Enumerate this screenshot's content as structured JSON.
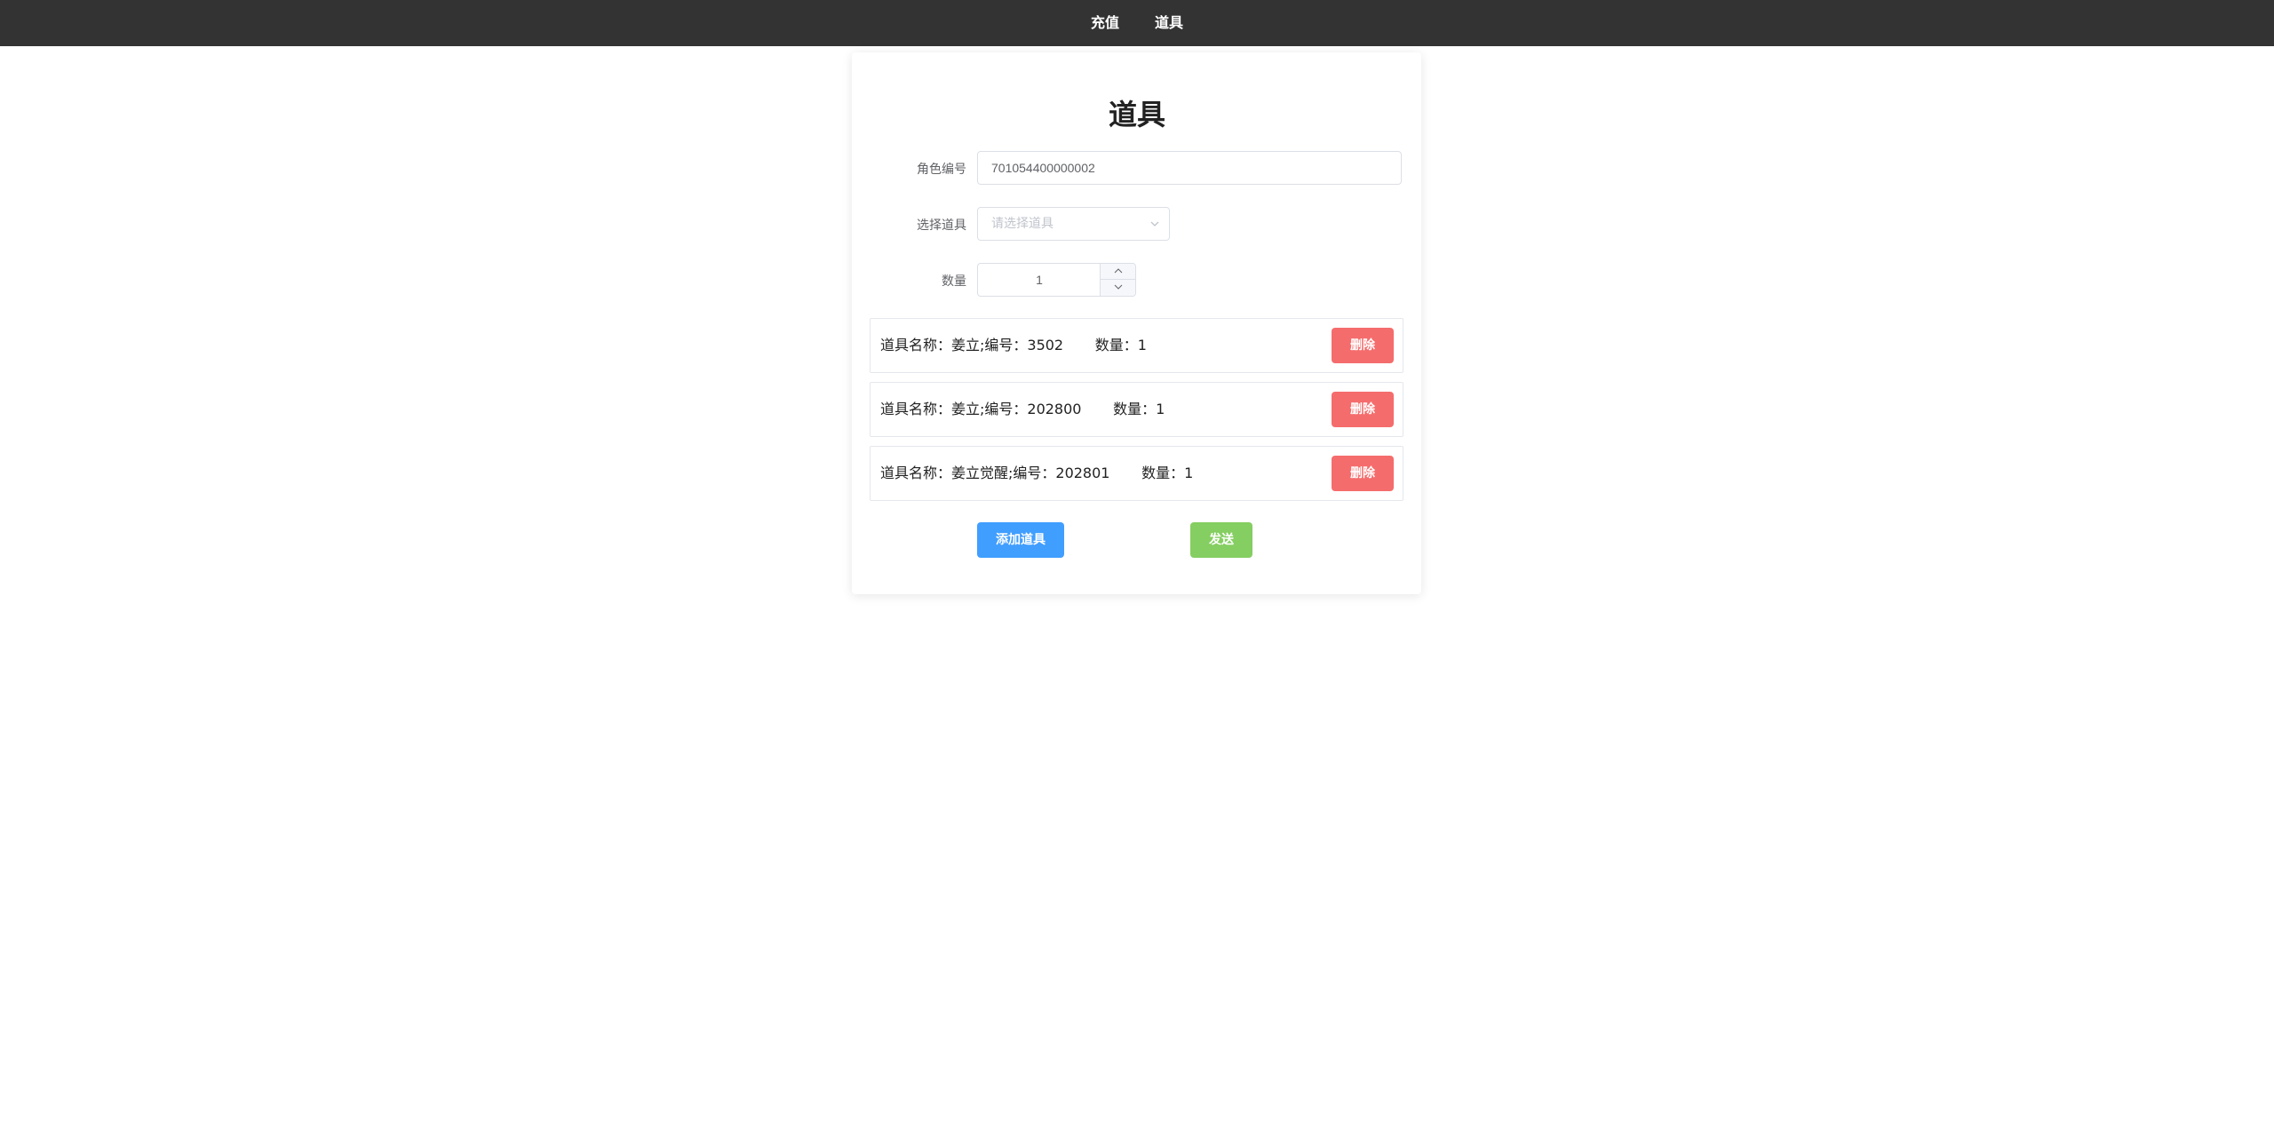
{
  "nav": {
    "items": [
      {
        "label": "充值"
      },
      {
        "label": "道具"
      }
    ]
  },
  "page": {
    "title": "道具"
  },
  "form": {
    "role_label": "角色编号",
    "role_value": "701054400000002",
    "item_label": "选择道具",
    "item_placeholder": "请选择道具",
    "qty_label": "数量",
    "qty_value": "1"
  },
  "items": [
    {
      "text": "道具名称：姜立;编号：3502       数量：1",
      "delete_label": "删除"
    },
    {
      "text": "道具名称：姜立;编号：202800       数量：1",
      "delete_label": "删除"
    },
    {
      "text": "道具名称：姜立觉醒;编号：202801       数量：1",
      "delete_label": "删除"
    }
  ],
  "actions": {
    "add_label": "添加道具",
    "send_label": "发送"
  },
  "colors": {
    "topbar": "#333333",
    "danger": "#f56c6c",
    "primary": "#409eff",
    "success": "#85ce61"
  },
  "icons": {
    "select_arrow": "chevron-down-icon",
    "stepper_up": "chevron-up-icon",
    "stepper_down": "chevron-down-icon"
  }
}
